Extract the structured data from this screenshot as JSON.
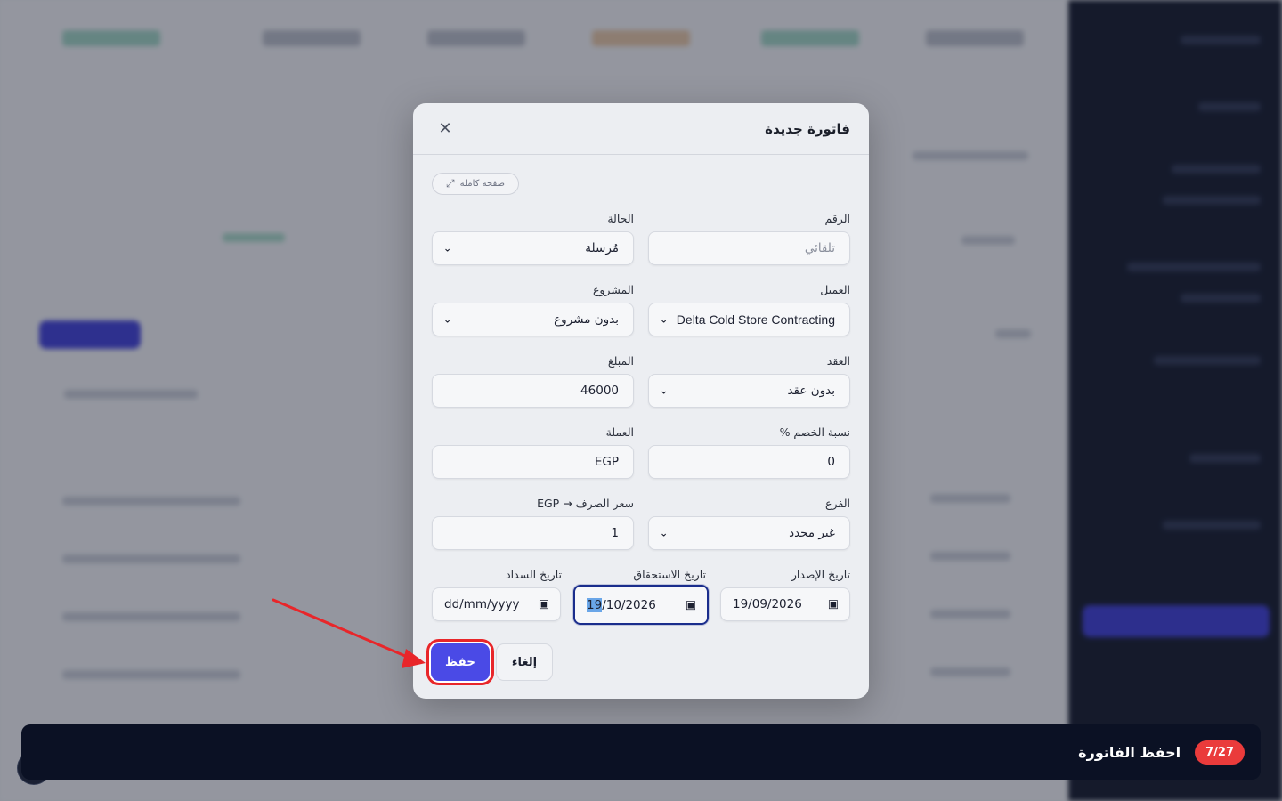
{
  "modal": {
    "title": "فاتورة جديدة",
    "close_symbol": "✕",
    "fullpage_label": "صفحة كاملة",
    "fields": {
      "number": {
        "label": "الرقم",
        "placeholder": "تلقائي"
      },
      "status": {
        "label": "الحالة",
        "value": "مُرسلة"
      },
      "client": {
        "label": "العميل",
        "value": "Delta Cold Store Contracting"
      },
      "project": {
        "label": "المشروع",
        "value": "بدون مشروع"
      },
      "contract": {
        "label": "العقد",
        "value": "بدون عقد"
      },
      "amount": {
        "label": "المبلغ",
        "value": "46000"
      },
      "discount": {
        "label": "نسبة الخصم %",
        "value": "0"
      },
      "currency": {
        "label": "العملة",
        "value": "EGP"
      },
      "branch": {
        "label": "الفرع",
        "value": "غير محدد"
      },
      "exchange_rate": {
        "label": "سعر الصرف → EGP",
        "value": "1"
      },
      "issue_date": {
        "label": "تاريخ الإصدار",
        "value": "19/09/2026"
      },
      "due_date": {
        "label": "تاريخ الاستحقاق",
        "value_highlight": "19",
        "value_rest": "/10/2026"
      },
      "payment_date": {
        "label": "تاريخ السداد",
        "placeholder": "dd/mm/yyyy"
      }
    },
    "save_label": "حفظ",
    "cancel_label": "إلغاء"
  },
  "icons": {
    "chevron": "chevron-down-icon",
    "calendar": "calendar-icon",
    "expand": "expand-icon",
    "close": "close-icon"
  },
  "tutorial": {
    "step": "7/27",
    "instruction": "احفظ الفاتورة"
  },
  "colors": {
    "primary": "#4a4ae6",
    "highlight_outline": "#e8262a",
    "step_badge": "#ea3b3b",
    "tutorial_bar": "#0b1124",
    "focus_border": "#1a2d8c"
  }
}
